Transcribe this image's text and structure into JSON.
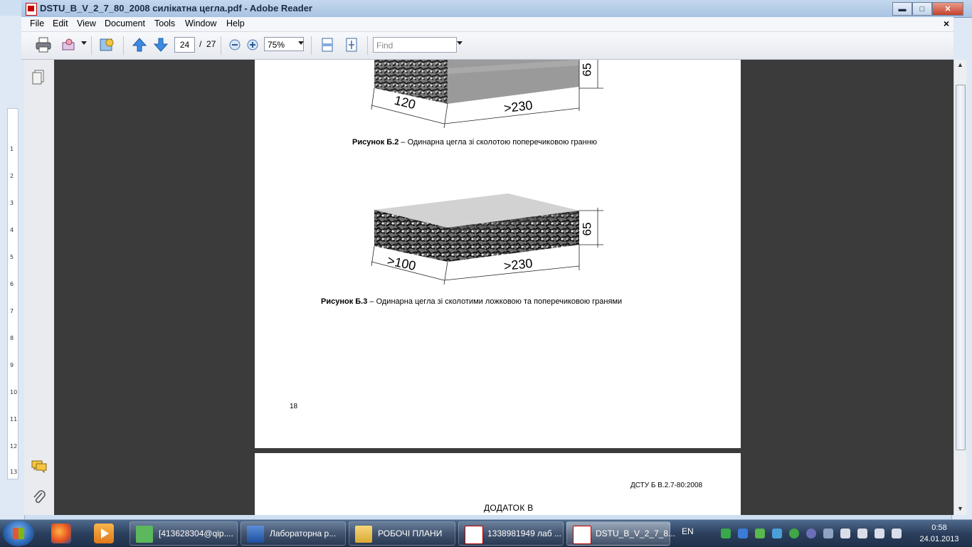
{
  "window": {
    "title": "DSTU_B_V_2_7_80_2008 силікатна цегла.pdf - Adobe Reader",
    "minimize": "▬",
    "maximize": "□",
    "close": "✕"
  },
  "menu": {
    "items": [
      "File",
      "Edit",
      "View",
      "Document",
      "Tools",
      "Window",
      "Help"
    ],
    "doc_close": "×"
  },
  "toolbar": {
    "current_page": "24",
    "page_sep": "/",
    "total_pages": "27",
    "zoom": "75%",
    "find_placeholder": "Find"
  },
  "document": {
    "figure_b2": {
      "dim_width": "120",
      "dim_length": ">230",
      "dim_height": "65",
      "caption_bold": "Рисунок Б.2",
      "caption_text": " – Одинарна цегла зі сколотою поперечиковою гранню"
    },
    "figure_b3": {
      "dim_width": ">100",
      "dim_length": ">230",
      "dim_height": "65",
      "caption_bold": "Рисунок Б.3",
      "caption_text": " – Одинарна цегла зі сколотими ложковою та поперечиковою гранями"
    },
    "page_number": "18",
    "next_page_code": "ДСТУ Б В.2.7-80:2008",
    "next_page_heading": "ДОДАТОК В"
  },
  "background_window": {
    "ruler_numbers": [
      "1",
      "2",
      "3",
      "4",
      "5",
      "6",
      "7",
      "8",
      "9",
      "10",
      "11",
      "12",
      "13"
    ]
  },
  "taskbar": {
    "tasks": [
      {
        "label": "[413628304@qip...."
      },
      {
        "label": "Лабораторна р..."
      },
      {
        "label": "РОБОЧІ ПЛАНИ"
      },
      {
        "label": "1338981949 лаб ..."
      },
      {
        "label": "DSTU_B_V_2_7_8..."
      }
    ],
    "language": "EN",
    "time": "0:58",
    "date": "24.01.2013"
  }
}
